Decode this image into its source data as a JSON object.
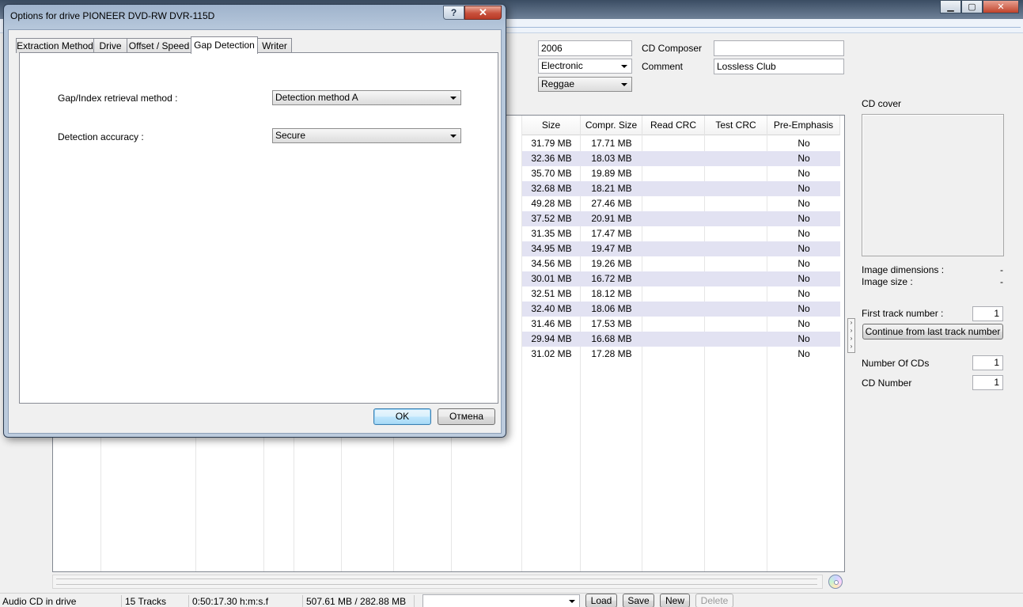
{
  "main": {
    "window_controls": {
      "minimize": "▁",
      "maximize": "▢",
      "close": "✕"
    },
    "cd_info": {
      "year": "2006",
      "genre": "Electronic",
      "style": "Reggae",
      "composer_label": "CD Composer",
      "composer_value": "",
      "comment_label": "Comment",
      "comment_value": "Lossless Club"
    },
    "columns": [
      "Size",
      "Compr. Size",
      "Read CRC",
      "Test CRC",
      "Pre-Emphasis"
    ],
    "tracks": [
      {
        "size": "31.79 MB",
        "compr": "17.71 MB",
        "read_crc": "",
        "test_crc": "",
        "pre": "No"
      },
      {
        "size": "32.36 MB",
        "compr": "18.03 MB",
        "read_crc": "",
        "test_crc": "",
        "pre": "No"
      },
      {
        "size": "35.70 MB",
        "compr": "19.89 MB",
        "read_crc": "",
        "test_crc": "",
        "pre": "No"
      },
      {
        "size": "32.68 MB",
        "compr": "18.21 MB",
        "read_crc": "",
        "test_crc": "",
        "pre": "No"
      },
      {
        "size": "49.28 MB",
        "compr": "27.46 MB",
        "read_crc": "",
        "test_crc": "",
        "pre": "No"
      },
      {
        "size": "37.52 MB",
        "compr": "20.91 MB",
        "read_crc": "",
        "test_crc": "",
        "pre": "No"
      },
      {
        "size": "31.35 MB",
        "compr": "17.47 MB",
        "read_crc": "",
        "test_crc": "",
        "pre": "No"
      },
      {
        "size": "34.95 MB",
        "compr": "19.47 MB",
        "read_crc": "",
        "test_crc": "",
        "pre": "No"
      },
      {
        "size": "34.56 MB",
        "compr": "19.26 MB",
        "read_crc": "",
        "test_crc": "",
        "pre": "No"
      },
      {
        "size": "30.01 MB",
        "compr": "16.72 MB",
        "read_crc": "",
        "test_crc": "",
        "pre": "No"
      },
      {
        "size": "32.51 MB",
        "compr": "18.12 MB",
        "read_crc": "",
        "test_crc": "",
        "pre": "No"
      },
      {
        "size": "32.40 MB",
        "compr": "18.06 MB",
        "read_crc": "",
        "test_crc": "",
        "pre": "No"
      },
      {
        "size": "31.46 MB",
        "compr": "17.53 MB",
        "read_crc": "",
        "test_crc": "",
        "pre": "No"
      },
      {
        "size": "29.94 MB",
        "compr": "16.68 MB",
        "read_crc": "",
        "test_crc": "",
        "pre": "No"
      },
      {
        "size": "31.02 MB",
        "compr": "17.28 MB",
        "read_crc": "",
        "test_crc": "",
        "pre": "No"
      }
    ],
    "right_panel": {
      "cover_label": "CD cover",
      "image_dimensions_label": "Image dimensions :",
      "image_dimensions_value": "-",
      "image_size_label": "Image size :",
      "image_size_value": "-",
      "first_track_label": "First track number :",
      "first_track_value": "1",
      "continue_button": "Continue from last track number",
      "number_of_cds_label": "Number Of CDs",
      "number_of_cds_value": "1",
      "cd_number_label": "CD Number",
      "cd_number_value": "1"
    },
    "statusbar": {
      "drive_status": "Audio CD in drive",
      "tracks": "15 Tracks",
      "duration": "0:50:17.30 h:m:s.f",
      "sizes": "507.61 MB / 282.88 MB",
      "profile_value": "",
      "load": "Load",
      "save": "Save",
      "new": "New",
      "delete": "Delete"
    }
  },
  "dialog": {
    "title": "Options for drive PIONEER DVD-RW  DVR-115D",
    "help": "?",
    "close": "✕",
    "tabs": [
      "Extraction Method",
      "Drive",
      "Offset / Speed",
      "Gap Detection",
      "Writer"
    ],
    "active_tab": "Gap Detection",
    "gap_method_label": "Gap/Index retrieval method :",
    "gap_method_value": "Detection method A",
    "accuracy_label": "Detection accuracy :",
    "accuracy_value": "Secure",
    "ok": "OK",
    "cancel": "Отмена"
  },
  "colors": {
    "row_alt": "#e2e2f2",
    "dialog_frame": "#b6c7db",
    "default_button": "#bee6fd"
  }
}
